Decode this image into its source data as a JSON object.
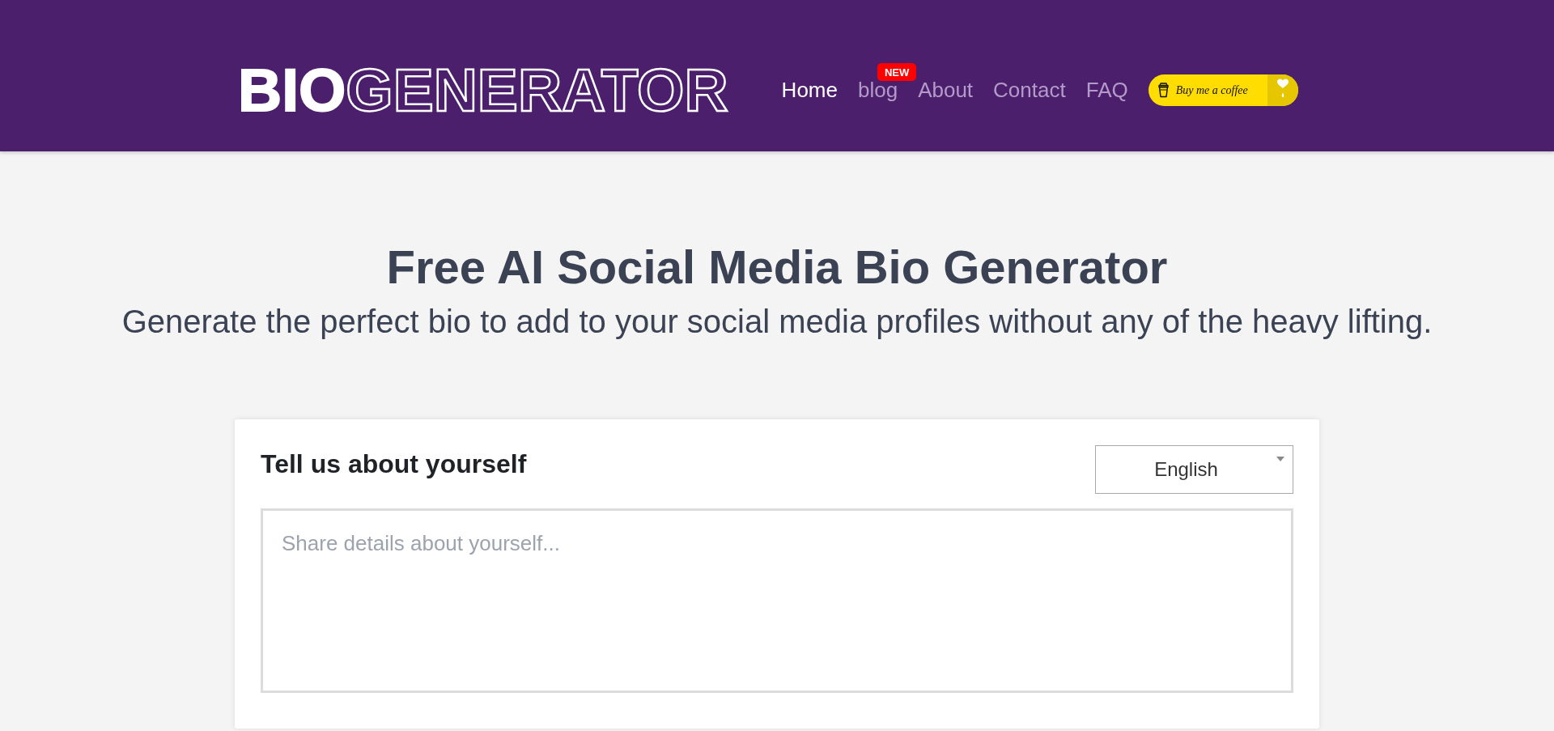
{
  "header": {
    "logo": {
      "solid": "BIO",
      "outline": "GENERATOR"
    },
    "nav": [
      {
        "label": "Home",
        "selected": true
      },
      {
        "label": "blog",
        "selected": false,
        "badge": "NEW"
      },
      {
        "label": "About",
        "selected": false
      },
      {
        "label": "Contact",
        "selected": false
      },
      {
        "label": "FAQ",
        "selected": false
      }
    ],
    "coffee_button": {
      "label": "Buy me a coffee"
    }
  },
  "hero": {
    "title": "Free AI Social Media Bio Generator",
    "subtitle": "Generate the perfect bio to add to your social media profiles without any of the heavy lifting."
  },
  "form": {
    "heading": "Tell us about yourself",
    "language": "English",
    "details": {
      "placeholder": "Share details about yourself..."
    }
  }
}
